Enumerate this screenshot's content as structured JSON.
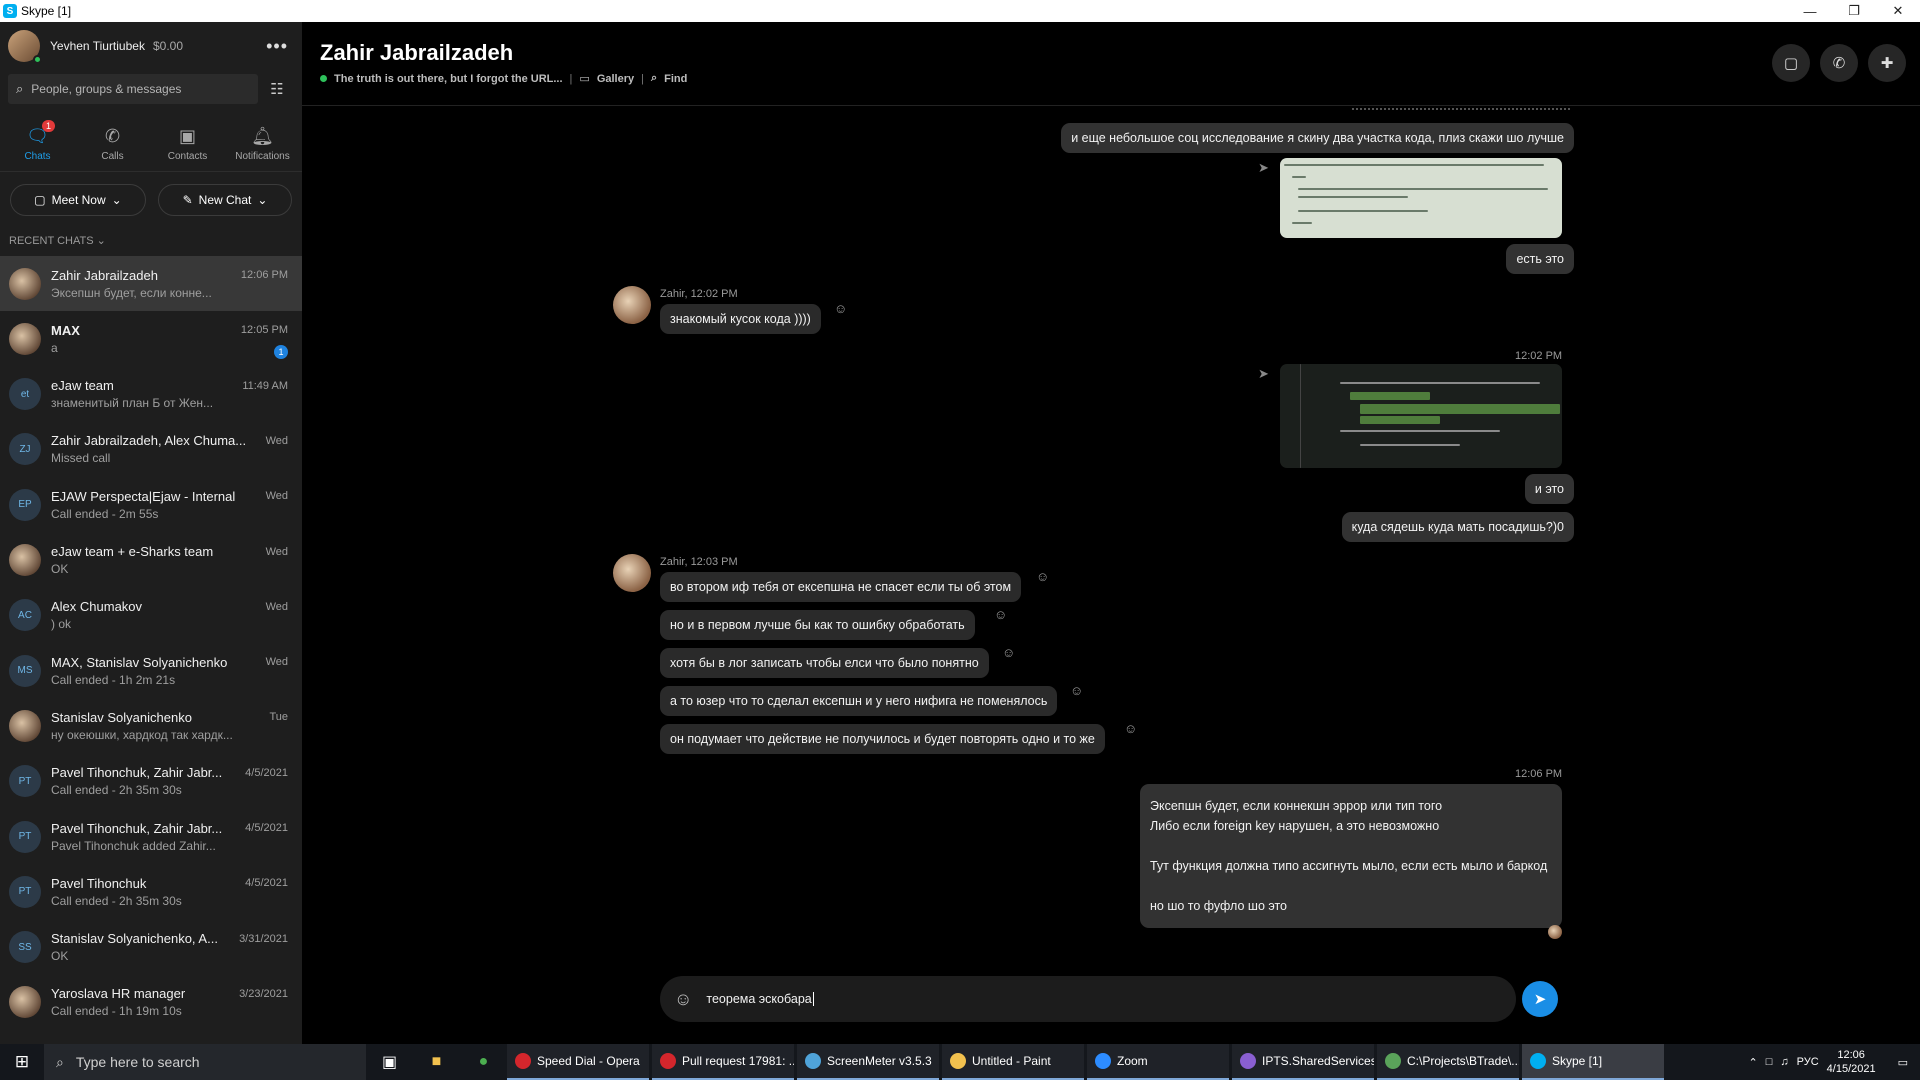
{
  "window": {
    "title": "Skype [1]",
    "controls": [
      "—",
      "❐",
      "✕"
    ]
  },
  "profile": {
    "name": "Yevhen Tiurtiubek",
    "credit": "$0.00",
    "more": "•••"
  },
  "search": {
    "placeholder": "People, groups & messages"
  },
  "nav_tabs": [
    {
      "label": "Chats",
      "icon": "chat-icon",
      "badge": "1",
      "active": true
    },
    {
      "label": "Calls",
      "icon": "phone-icon"
    },
    {
      "label": "Contacts",
      "icon": "contacts-icon"
    },
    {
      "label": "Notifications",
      "icon": "bell-icon"
    }
  ],
  "actions": {
    "meet_now": "Meet Now",
    "new_chat": "New Chat"
  },
  "recent_header": "RECENT CHATS",
  "chats": [
    {
      "name": "Zahir Jabrailzadeh",
      "preview": "Эксепшн будет, если конне...",
      "time": "12:06 PM",
      "active": true,
      "initials": ""
    },
    {
      "name": "MAX",
      "preview": "a",
      "time": "12:05 PM",
      "bold": true,
      "unread": "1",
      "initials": ""
    },
    {
      "name": "eJaw team",
      "preview": "знаменитый план Б от Жен...",
      "time": "11:49 AM",
      "initials": "et"
    },
    {
      "name": "Zahir Jabrailzadeh, Alex Chuma...",
      "preview": "Missed call",
      "time": "Wed",
      "initials": "ZJ"
    },
    {
      "name": "EJAW Perspecta|Ejaw - Internal",
      "preview": "Call ended - 2m 55s",
      "time": "Wed",
      "initials": "EP"
    },
    {
      "name": "eJaw team + e-Sharks team",
      "preview": "OK",
      "time": "Wed",
      "initials": ""
    },
    {
      "name": "Alex Chumakov",
      "preview": ") ok",
      "time": "Wed",
      "initials": "AC"
    },
    {
      "name": "MAX, Stanislav Solyanichenko",
      "preview": "Call ended - 1h 2m 21s",
      "time": "Wed",
      "initials": "MS"
    },
    {
      "name": "Stanislav Solyanichenko",
      "preview": "ну океюшки, хардкод так хардк...",
      "time": "Tue",
      "initials": ""
    },
    {
      "name": "Pavel Tihonchuk, Zahir Jabr...",
      "preview": "Call ended - 2h 35m 30s",
      "time": "4/5/2021",
      "initials": "PT"
    },
    {
      "name": "Pavel Tihonchuk, Zahir Jabr...",
      "preview": "Pavel Tihonchuk added Zahir...",
      "time": "4/5/2021",
      "initials": "PT"
    },
    {
      "name": "Pavel Tihonchuk",
      "preview": "Call ended - 2h 35m 30s",
      "time": "4/5/2021",
      "initials": "PT"
    },
    {
      "name": "Stanislav Solyanichenko, A...",
      "preview": "OK",
      "time": "3/31/2021",
      "initials": "SS"
    },
    {
      "name": "Yaroslava HR manager",
      "preview": "Call ended - 1h 19m 10s",
      "time": "3/23/2021",
      "initials": ""
    }
  ],
  "conversation": {
    "title": "Zahir Jabrailzadeh",
    "status": "The truth is out there, but I forgot the URL...",
    "gallery": "Gallery",
    "find": "Find",
    "messages": {
      "out1": "и еще небольшое соц исследование я скину два участка кода, плиз скажи шо лучше",
      "out2": "есть это",
      "in1_meta": "Zahir, 12:02 PM",
      "in1": "знакомый кусок кода ))))",
      "out_time2": "12:02 PM",
      "out3": "и это",
      "out4": "куда сядешь куда мать посадишь?)0",
      "in2_meta": "Zahir, 12:03 PM",
      "in2": [
        "во втором иф тебя от ексепшна не спасет если ты об этом",
        "но и в первом лучше бы как то ошибку обработать",
        "хотя бы в лог записать чтобы елси что было понятно",
        "а то юзер что то сделал ексепшн и у него нифига не поменялось",
        "он подумает что действие не получилось и будет повторять одно и то же"
      ],
      "out_time3": "12:06 PM",
      "out5": [
        "Эксепшн будет, если коннекшн эррор или тип того",
        "Либо если foreign key нарушен, а это невозможно",
        "Тут функция должна типо ассигнуть мыло, если есть мыло и баркод",
        "но шо то фуфло шо это"
      ]
    }
  },
  "composer": {
    "text": "теорема эскобара"
  },
  "taskbar": {
    "search_placeholder": "Type here to search",
    "apps": [
      {
        "label": "Speed Dial - Opera",
        "color": "#d4262c"
      },
      {
        "label": "Pull request 17981: ...",
        "color": "#d4262c"
      },
      {
        "label": "ScreenMeter v3.5.3",
        "color": "#4fa3d9"
      },
      {
        "label": "Untitled - Paint",
        "color": "#f2c14e"
      },
      {
        "label": "Zoom",
        "color": "#2d8cff"
      },
      {
        "label": "IPTS.SharedServices...",
        "color": "#8a5fd1"
      },
      {
        "label": "C:\\Projects\\BTrade\\...",
        "color": "#5aa35a"
      },
      {
        "label": "Skype [1]",
        "color": "#00aff0",
        "active": true
      }
    ],
    "language": "РУС",
    "time": "12:06",
    "date": "4/15/2021"
  },
  "colors": {
    "accent": "#1f9ee9",
    "online": "#2ec15b",
    "send": "#1a8ee6"
  }
}
